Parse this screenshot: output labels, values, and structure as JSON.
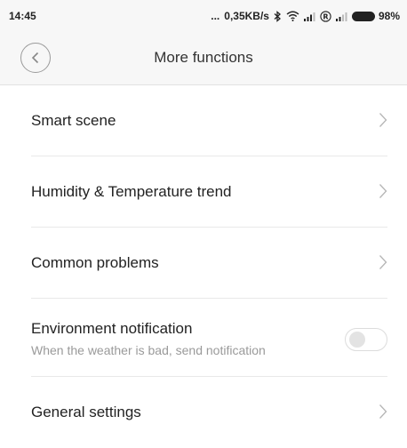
{
  "status_bar": {
    "time": "14:45",
    "dots": "...",
    "network_speed": "0,35KB/s",
    "battery_percent": "98%",
    "icons": [
      "bluetooth-icon",
      "wifi-icon",
      "signal-icon",
      "roaming-icon",
      "signal-icon",
      "battery-icon"
    ]
  },
  "header": {
    "title": "More functions",
    "back_icon": "back-chevron-icon"
  },
  "menu": {
    "items": [
      {
        "label": "Smart scene"
      },
      {
        "label": "Humidity & Temperature trend"
      },
      {
        "label": "Common problems"
      }
    ],
    "environment": {
      "title": "Environment notification",
      "subtitle": "When the weather is bad, send notification",
      "enabled": false
    },
    "general": {
      "label": "General settings"
    }
  },
  "colors": {
    "header_bg": "#f7f7f7",
    "text_primary": "#222222",
    "text_secondary": "#9a9a9a",
    "divider": "#e8e8e8",
    "chevron": "#b5b5b5"
  }
}
